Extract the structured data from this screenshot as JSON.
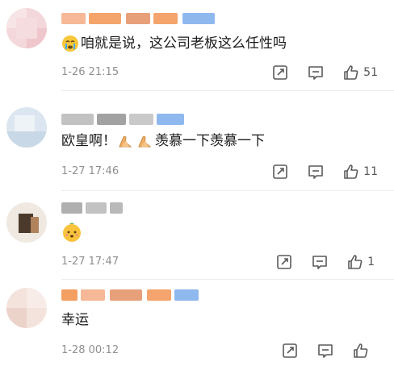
{
  "comments": [
    {
      "text": "咱就是说，这公司老板这么任性吗",
      "time": "1-26 21:15",
      "likes": "51"
    },
    {
      "text": "欧皇啊！",
      "text_after": "羡慕一下羡慕一下",
      "time": "1-27 17:46",
      "likes": "11"
    },
    {
      "time": "1-27 17:47",
      "likes": "1"
    },
    {
      "text": "幸运",
      "time": "1-28 00:12",
      "likes": ""
    }
  ],
  "icons": {
    "repost": "repost-icon",
    "comment": "comment-icon",
    "like": "thumbs-up-icon",
    "crying": "crying-face-emoji",
    "clap": "folded-hands-emoji",
    "face": "tangerine-face-emoji"
  },
  "colors": {
    "text": "#1a1a1a",
    "meta": "#8f8f8f",
    "icon": "#5a5a5a",
    "blur_orange": "#f0873a",
    "blur_blue": "#8fb8ef"
  }
}
